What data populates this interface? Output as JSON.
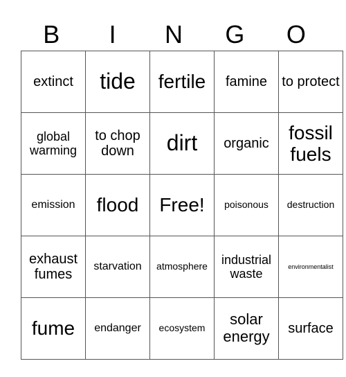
{
  "header": [
    "B",
    "I",
    "N",
    "G",
    "O"
  ],
  "rows": [
    [
      "extinct",
      "tide",
      "fertile",
      "famine",
      "to protect"
    ],
    [
      "global warming",
      "to chop down",
      "dirt",
      "organic",
      "fossil fuels"
    ],
    [
      "emission",
      "flood",
      "Free!",
      "poisonous",
      "destruction"
    ],
    [
      "exhaust fumes",
      "starvation",
      "atmosphere",
      "industrial waste",
      "environmentalist"
    ],
    [
      "fume",
      "endanger",
      "ecosystem",
      "solar energy",
      "surface"
    ]
  ]
}
